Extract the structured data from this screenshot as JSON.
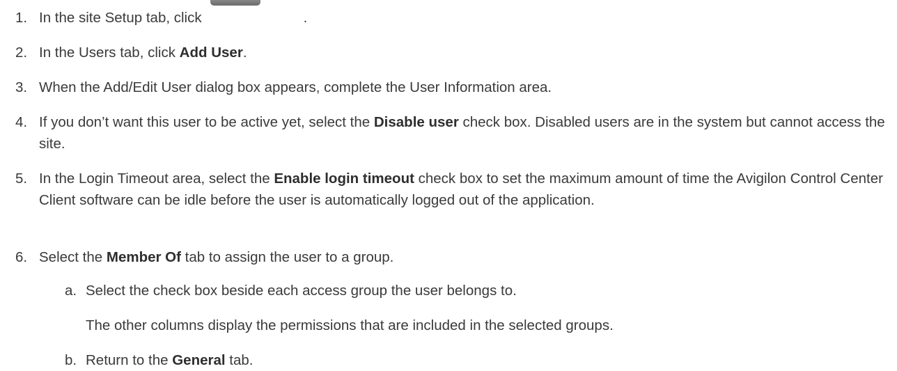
{
  "steps": [
    {
      "num": "1.",
      "parts": [
        "In the site Setup tab, click",
        "."
      ],
      "button_icon": "setup-users-button-icon"
    },
    {
      "num": "2.",
      "pre": "In the Users tab, click ",
      "bold": "Add User",
      "post": "."
    },
    {
      "num": "3.",
      "text": "When the Add/Edit User dialog box appears, complete the User Information area."
    },
    {
      "num": "4.",
      "pre": "If you don’t want this user to be active yet, select the ",
      "bold": "Disable user",
      "post": " check box. Disabled users are in the system but cannot access the site."
    },
    {
      "num": "5.",
      "pre": "In the Login Timeout area, select the ",
      "bold": "Enable login timeout",
      "post": " check box to set the maximum amount of time the Avigilon Control Center Client software can be idle before the user is automatically logged out of the application."
    },
    {
      "num": "6.",
      "pre": "Select the ",
      "bold": "Member Of",
      "post": " tab to assign the user to a group."
    }
  ],
  "substeps": [
    {
      "num": "a.",
      "text": "Select the check box beside each access group the user belongs to.",
      "note": "The other columns display the permissions that are included in the selected groups."
    },
    {
      "num": "b.",
      "pre": "Return to the ",
      "bold": "General",
      "post": " tab."
    }
  ]
}
